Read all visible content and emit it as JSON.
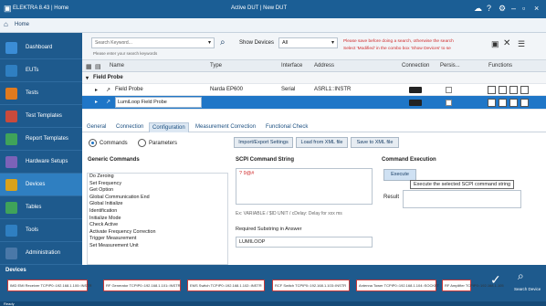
{
  "window": {
    "app_title": "ELEKTRA 8.43 | Home",
    "center_title": "Active DUT | New DUT"
  },
  "home": {
    "label": "Home"
  },
  "sidebar": {
    "items": [
      {
        "label": "Dashboard",
        "color": "#3b8dd6"
      },
      {
        "label": "EUTs",
        "color": "#2f7fc1"
      },
      {
        "label": "Tests",
        "color": "#e07a1e"
      },
      {
        "label": "Test Templates",
        "color": "#c94a3c"
      },
      {
        "label": "Report Templates",
        "color": "#3fa35a"
      },
      {
        "label": "Hardware Setups",
        "color": "#7c62b8"
      },
      {
        "label": "Devices",
        "color": "#d9a21b"
      },
      {
        "label": "Tables",
        "color": "#3fa35a"
      },
      {
        "label": "Tools",
        "color": "#2f7fc1"
      },
      {
        "label": "Administration",
        "color": "#4a78a8"
      }
    ]
  },
  "toolbar": {
    "search_placeholder": "Search Keyword...",
    "search_hint": "Please enter your search keywords",
    "show_devices_label": "Show Devices",
    "show_devices_value": "All",
    "warning": "Please save before doing a search, otherwise the search",
    "warning2": "Select 'Modified' in the combo box 'Show Devices' to se"
  },
  "columns": {
    "name": "Name",
    "type": "Type",
    "interface": "Interface",
    "address": "Address",
    "connection": "Connection",
    "persist": "Persis...",
    "functions": "Functions"
  },
  "rows": [
    {
      "name": "Field Probe",
      "type": "",
      "interface": "",
      "address": ""
    },
    {
      "name": "Field Probe",
      "type": "Narda EP600",
      "interface": "Serial",
      "address": "ASRL1::INSTR"
    },
    {
      "name": "LumiLoop Field Probe",
      "type": "",
      "interface": "",
      "address": ""
    }
  ],
  "tabs": [
    "General",
    "Connection",
    "Configuration",
    "Measurement Correction",
    "Functional Check"
  ],
  "radios": {
    "commands": "Commands",
    "parameters": "Parameters"
  },
  "buttons": {
    "import_export": "Import/Export Settings",
    "load_xml": "Load from XML file",
    "save_xml": "Save to XML file",
    "execute": "Execute"
  },
  "generic": {
    "title": "Generic Commands",
    "items": [
      "Do Zeroing",
      "Set Frequency",
      "Get Option",
      "Global Communication End",
      "Global Initialize",
      "Identification",
      "Initialize Mode",
      "Check Active",
      "Activate Frequency Correction",
      "Trigger Measurement",
      "Set Measurement Unit"
    ]
  },
  "scpi": {
    "title": "SCPI Command String",
    "value": "? 9@#",
    "hint": "Ex: VARIABLE / $ID UNIT / cDelay: Delay for xxx ms",
    "expected_label": "Required Substring in Answer",
    "expected_value": "LUMILOOP"
  },
  "exec": {
    "title": "Command Execution",
    "result_label": "Result",
    "tooltip": "Execute the selected SCPI command string"
  },
  "devices_panel": {
    "title": "Devices",
    "cards": [
      "IMD EMI Receiver TCPIP0::192.168.1.100::INSTR",
      "RF Generator TCPIP0::192.168.1.101::INSTR",
      "EMS Switch TCPIP0::192.168.1.102::INSTR",
      "RCF Switch TCPIP0::192.168.1.103::INSTR",
      "Antenna Tower TCPIP0::192.168.1.104::SOCKET",
      "RF Amplifier TCPIP0::192.168.1.105"
    ],
    "ok_label": "",
    "search_label": "Search Device"
  },
  "status": {
    "text": "Ready"
  }
}
